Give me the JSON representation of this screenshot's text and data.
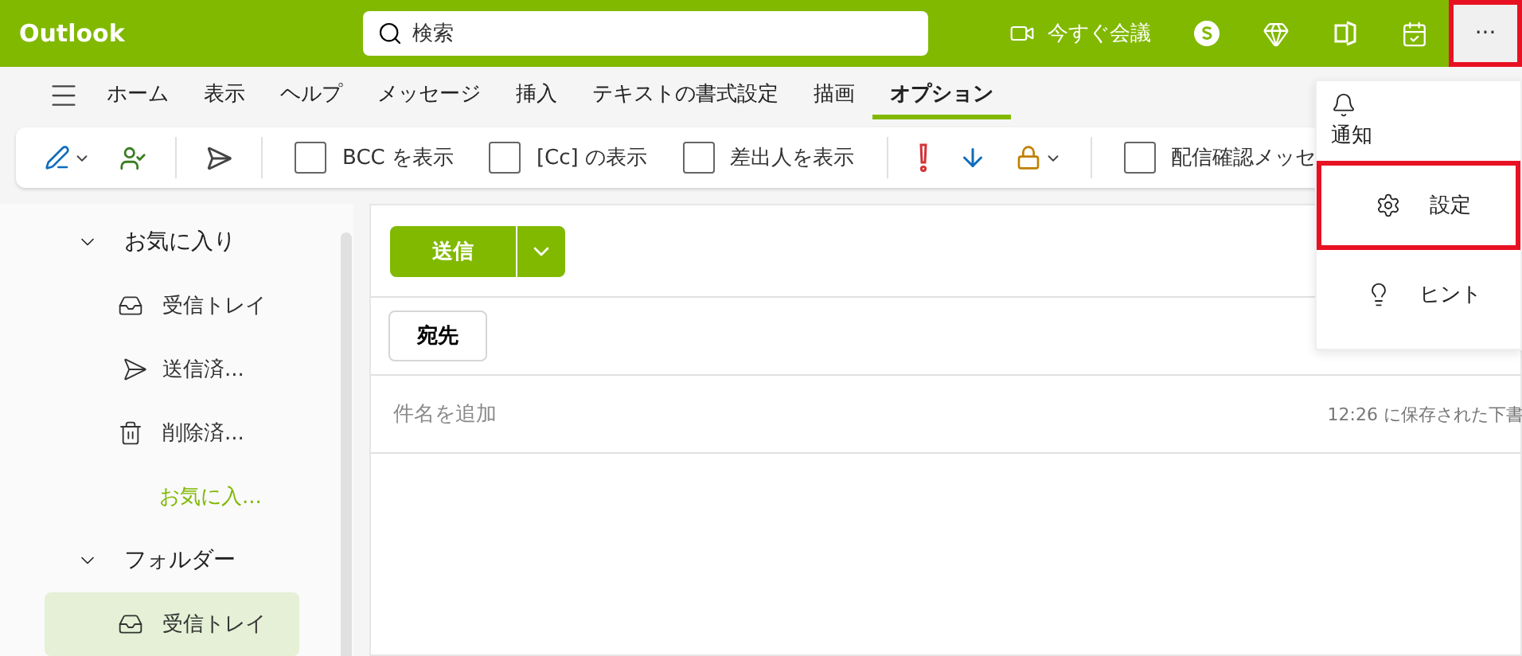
{
  "app": {
    "title": "Outlook"
  },
  "search": {
    "placeholder": "検索"
  },
  "header_actions": {
    "meet_now": "今すぐ会議",
    "more": {
      "label": "···",
      "highlighted": true
    }
  },
  "tabs": [
    {
      "label": "ホーム",
      "selected": false
    },
    {
      "label": "表示",
      "selected": false
    },
    {
      "label": "ヘルプ",
      "selected": false
    },
    {
      "label": "メッセージ",
      "selected": false
    },
    {
      "label": "挿入",
      "selected": false
    },
    {
      "label": "テキストの書式設定",
      "selected": false
    },
    {
      "label": "描画",
      "selected": false
    },
    {
      "label": "オプション",
      "selected": true
    }
  ],
  "ribbon": {
    "checkboxes": [
      {
        "label": "BCC を表示",
        "checked": false
      },
      {
        "label": "[Cc] の表示",
        "checked": false
      },
      {
        "label": "差出人を表示",
        "checked": false
      },
      {
        "label": "配信確認メッセ",
        "checked": false
      }
    ]
  },
  "sidebar": {
    "items": [
      {
        "label": "お気に入り",
        "expanded": true,
        "children": [
          {
            "label": "受信トレイ",
            "kind": "inbox",
            "selected": false
          },
          {
            "label": "送信済...",
            "kind": "sent",
            "selected": false
          },
          {
            "label": "削除済...",
            "kind": "deleted",
            "selected": false
          },
          {
            "label": "お気に入...",
            "kind": "link",
            "selected": false
          }
        ]
      },
      {
        "label": "フォルダー",
        "expanded": true,
        "children": [
          {
            "label": "受信トレイ",
            "kind": "inbox",
            "selected": true
          }
        ]
      }
    ]
  },
  "compose": {
    "send": "送信",
    "to": "宛先",
    "subject": {
      "placeholder": "件名を追加"
    },
    "saved_status": "12:26 に保存された下書"
  },
  "menu": {
    "items": [
      {
        "label": "通知",
        "kind": "bell",
        "highlighted": false
      },
      {
        "label": "設定",
        "kind": "settings",
        "highlighted": true
      },
      {
        "label": "ヒント",
        "kind": "tip",
        "highlighted": false
      }
    ]
  }
}
